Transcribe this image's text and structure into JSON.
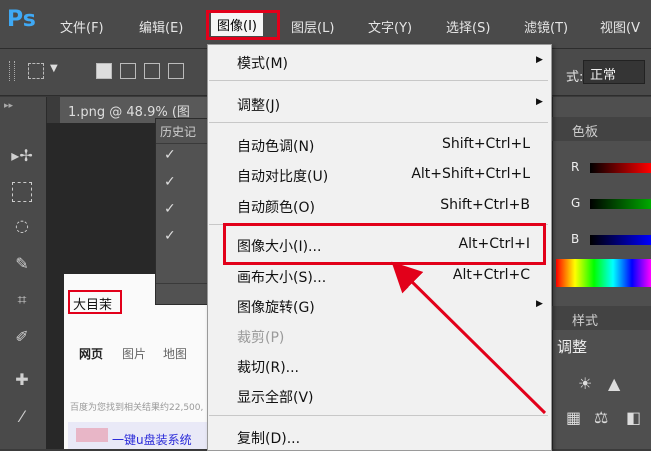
{
  "app": {
    "logo": "Ps"
  },
  "menubar": {
    "items": [
      {
        "label": "文件(F)"
      },
      {
        "label": "编辑(E)"
      },
      {
        "label": "图像(I)"
      },
      {
        "label": "图层(L)"
      },
      {
        "label": "文字(Y)"
      },
      {
        "label": "选择(S)"
      },
      {
        "label": "滤镜(T)"
      },
      {
        "label": "视图(V"
      }
    ]
  },
  "options_bar": {
    "blend_label": "式:",
    "blend_value": "正常"
  },
  "document": {
    "tab": "1.png @ 48.9% (图"
  },
  "history_panel": {
    "title": "历史记"
  },
  "doc_image": {
    "search_text": "大目茉",
    "tabs": [
      "网页",
      "图片",
      "地图"
    ],
    "info": "百度为您找到相关结果约22,500,",
    "ad_text": "一键u盘装系统"
  },
  "right_panel": {
    "color_tab": "色板",
    "channels": [
      "R",
      "G",
      "B"
    ],
    "styles_tab": "样式",
    "adjust_title": "调整"
  },
  "image_menu": {
    "items": [
      {
        "label": "模式(M)",
        "shortcut": "",
        "submenu": true,
        "disabled": false
      },
      {
        "label": "调整(J)",
        "shortcut": "",
        "submenu": true,
        "disabled": false
      },
      {
        "label": "自动色调(N)",
        "shortcut": "Shift+Ctrl+L",
        "submenu": false,
        "disabled": false
      },
      {
        "label": "自动对比度(U)",
        "shortcut": "Alt+Shift+Ctrl+L",
        "submenu": false,
        "disabled": false
      },
      {
        "label": "自动颜色(O)",
        "shortcut": "Shift+Ctrl+B",
        "submenu": false,
        "disabled": false
      },
      {
        "label": "图像大小(I)...",
        "shortcut": "Alt+Ctrl+I",
        "submenu": false,
        "disabled": false
      },
      {
        "label": "画布大小(S)...",
        "shortcut": "Alt+Ctrl+C",
        "submenu": false,
        "disabled": false
      },
      {
        "label": "图像旋转(G)",
        "shortcut": "",
        "submenu": true,
        "disabled": false
      },
      {
        "label": "裁剪(P)",
        "shortcut": "",
        "submenu": false,
        "disabled": true
      },
      {
        "label": "裁切(R)...",
        "shortcut": "",
        "submenu": false,
        "disabled": false
      },
      {
        "label": "显示全部(V)",
        "shortcut": "",
        "submenu": false,
        "disabled": false
      },
      {
        "label": "复制(D)...",
        "shortcut": "",
        "submenu": false,
        "disabled": false
      }
    ]
  },
  "colors": {
    "highlight": "#e2001a",
    "ps_logo": "#3fa9f5"
  }
}
